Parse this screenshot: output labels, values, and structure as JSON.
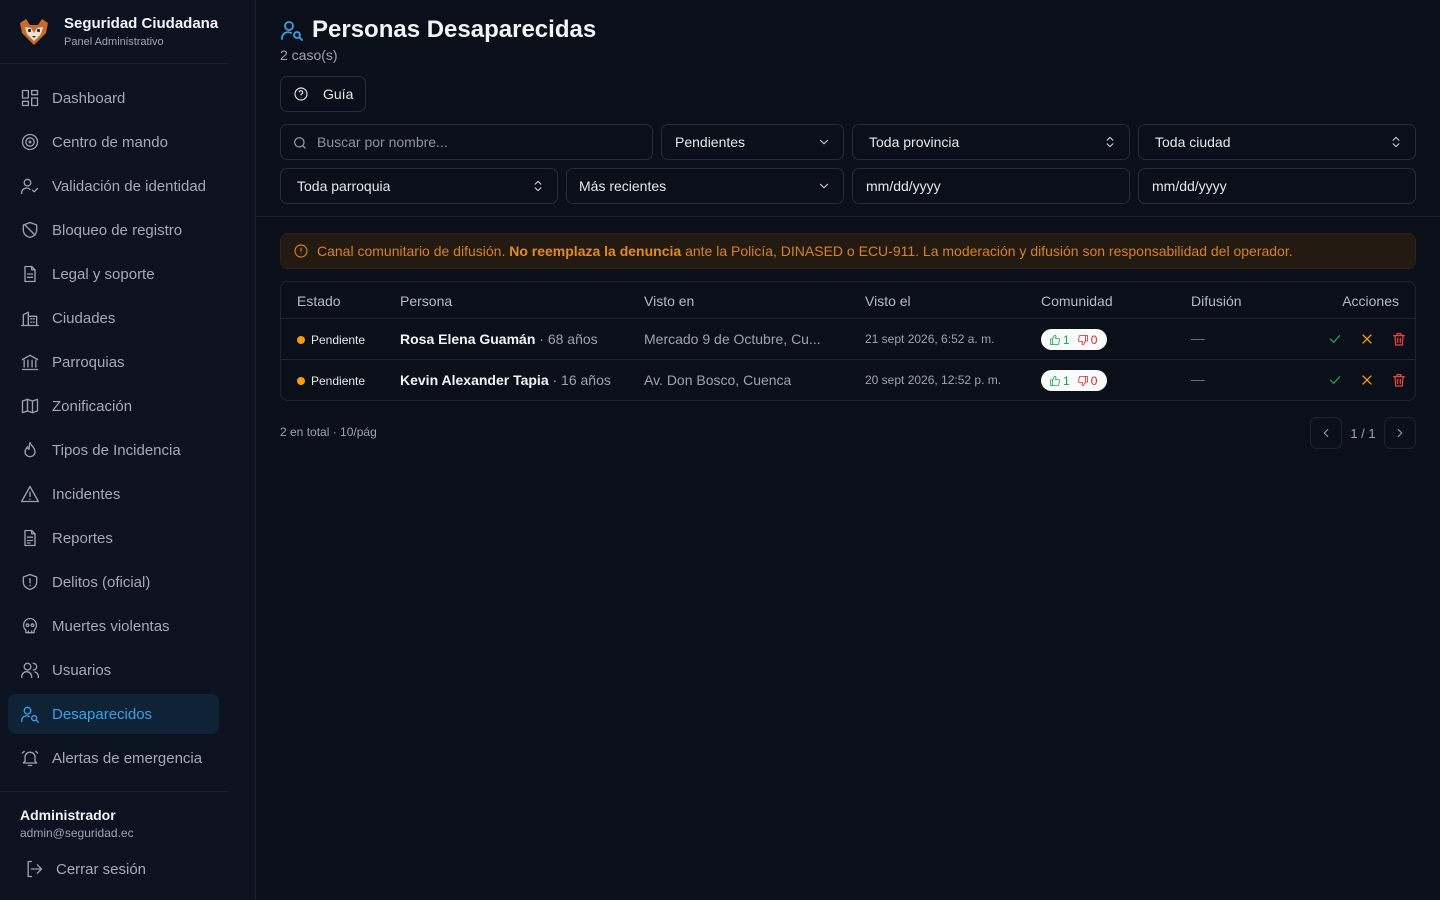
{
  "brand": {
    "title": "Seguridad Ciudadana",
    "subtitle": "Panel Administrativo"
  },
  "sidebar": {
    "items": [
      {
        "label": "Dashboard",
        "icon": "dashboard-icon"
      },
      {
        "label": "Centro de mando",
        "icon": "target-icon"
      },
      {
        "label": "Validación de identidad",
        "icon": "user-check-icon"
      },
      {
        "label": "Bloqueo de registro",
        "icon": "ban-icon"
      },
      {
        "label": "Legal y soporte",
        "icon": "document-icon"
      },
      {
        "label": "Ciudades",
        "icon": "buildings-icon"
      },
      {
        "label": "Parroquias",
        "icon": "landmark-icon"
      },
      {
        "label": "Zonificación",
        "icon": "map-icon"
      },
      {
        "label": "Tipos de Incidencia",
        "icon": "flame-icon"
      },
      {
        "label": "Incidentes",
        "icon": "warning-icon"
      },
      {
        "label": "Reportes",
        "icon": "report-icon"
      },
      {
        "label": "Delitos (oficial)",
        "icon": "shield-alert-icon"
      },
      {
        "label": "Muertes violentas",
        "icon": "skull-icon"
      },
      {
        "label": "Usuarios",
        "icon": "users-icon"
      },
      {
        "label": "Desaparecidos",
        "icon": "user-search-icon",
        "active": true
      },
      {
        "label": "Alertas de emergencia",
        "icon": "bell-ring-icon"
      }
    ],
    "user": {
      "name": "Administrador",
      "email": "admin@seguridad.ec"
    },
    "logout_label": "Cerrar sesión"
  },
  "header": {
    "title": "Personas Desaparecidas",
    "count": "2 caso(s)",
    "guide_label": "Guía"
  },
  "filters": {
    "search_placeholder": "Buscar por nombre...",
    "status": "Pendientes",
    "province": "Toda provincia",
    "city": "Toda ciudad",
    "parish": "Toda parroquia",
    "sort": "Más recientes",
    "date_from": "mm/dd/yyyy",
    "date_to": "mm/dd/yyyy"
  },
  "notice": {
    "pre": "Canal comunitario de difusión. ",
    "bold": "No reemplaza la denuncia",
    "post": " ante la Policía, DINASED o ECU-911. La moderación y difusión son responsabilidad del operador."
  },
  "table": {
    "columns": [
      "Estado",
      "Persona",
      "Visto en",
      "Visto el",
      "Comunidad",
      "Difusión",
      "Acciones"
    ],
    "rows": [
      {
        "status": "Pendiente",
        "name": "Rosa Elena Guamán",
        "age": " · 68 años",
        "place": "Mercado 9 de Octubre, Cu...",
        "seen": "21 sept 2026, 6:52 a. m.",
        "up": "1",
        "down": "0",
        "diffusion": "—"
      },
      {
        "status": "Pendiente",
        "name": "Kevin Alexander Tapia",
        "age": " · 16 años",
        "place": "Av. Don Bosco, Cuenca",
        "seen": "20 sept 2026, 12:52 p. m.",
        "up": "1",
        "down": "0",
        "diffusion": "—"
      }
    ]
  },
  "pagination": {
    "info": "2 en total · 10/pág",
    "page": "1 / 1"
  },
  "colors": {
    "accent": "#38a3e8",
    "pending": "#f59e0b",
    "notice": "#d9822b",
    "approve": "#22a35a",
    "delete": "#ef4444"
  }
}
